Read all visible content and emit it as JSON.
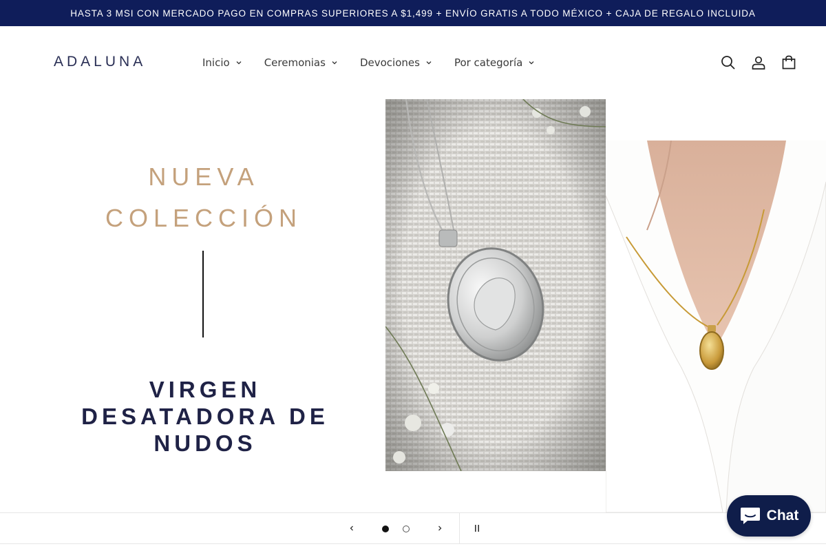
{
  "announcement": {
    "text": "HASTA 3 MSI CON MERCADO PAGO EN COMPRAS SUPERIORES A $1,499 + ENVÍO GRATIS A TODO MÉXICO + CAJA DE REGALO INCLUIDA"
  },
  "header": {
    "logo": "ADALUNA",
    "nav": [
      {
        "label": "Inicio"
      },
      {
        "label": "Ceremonias"
      },
      {
        "label": "Devociones"
      },
      {
        "label": "Por categoría"
      }
    ],
    "icons": [
      "search-icon",
      "account-icon",
      "cart-icon"
    ]
  },
  "hero": {
    "line1": "NUEVA",
    "line2": "COLECCIÓN",
    "title_line1": "VIRGEN",
    "title_line2": "DESATADORA DE",
    "title_line3": "NUDOS"
  },
  "slideshow": {
    "slide_count": 2,
    "active_slide": 1,
    "icons": [
      "chevron-left-icon",
      "chevron-right-icon",
      "pause-icon"
    ]
  },
  "chat": {
    "label": "Chat"
  },
  "colors": {
    "announcement_bg": "#0f1d5a",
    "gold": "#c4a17c",
    "navy": "#1f2246",
    "chat_bg": "#0f1d4a"
  }
}
